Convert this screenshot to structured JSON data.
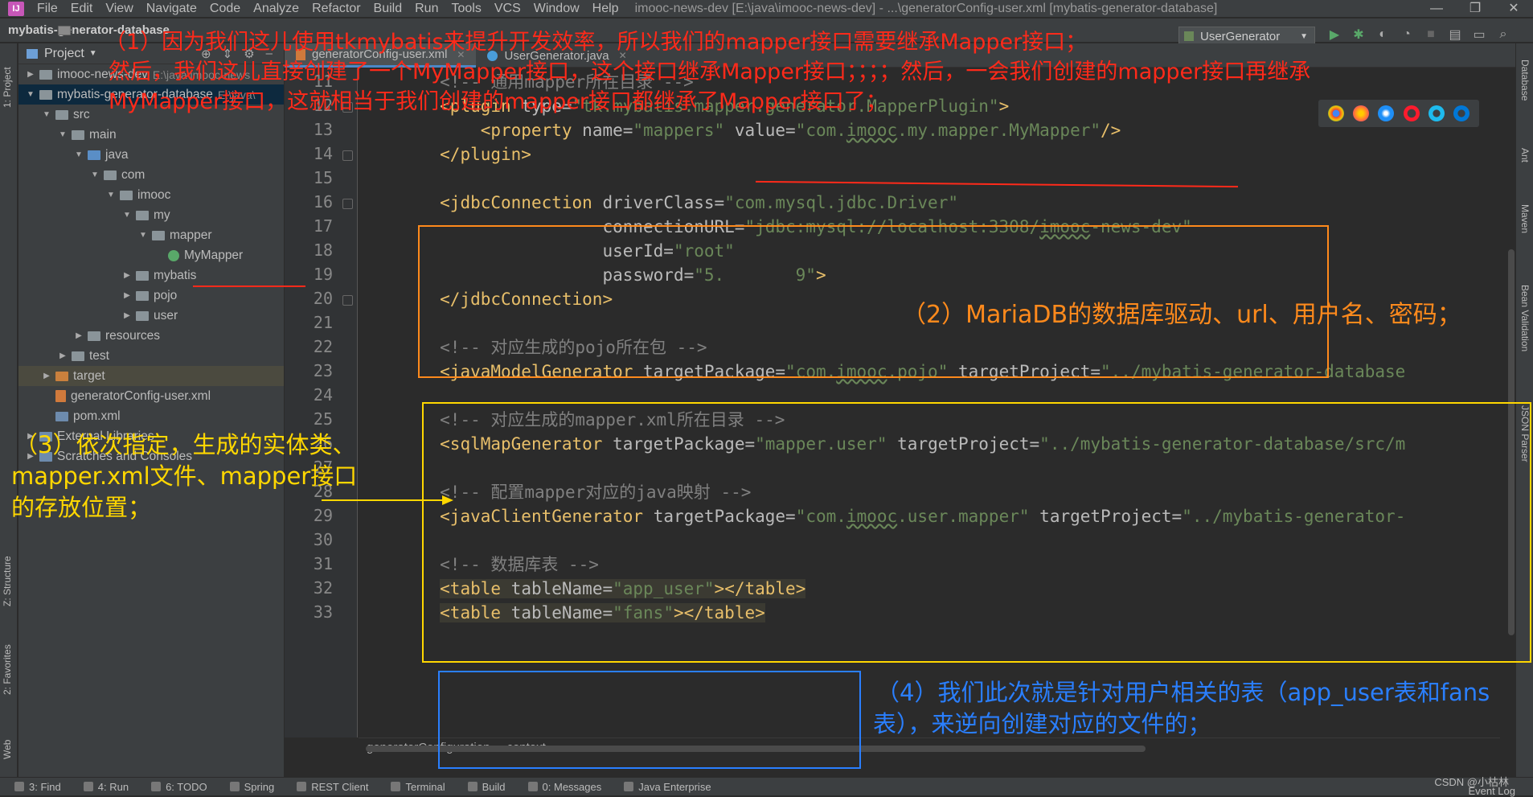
{
  "menubar": {
    "logo": "IJ",
    "items": [
      "File",
      "Edit",
      "View",
      "Navigate",
      "Code",
      "Analyze",
      "Refactor",
      "Build",
      "Run",
      "Tools",
      "VCS",
      "Window",
      "Help"
    ],
    "title": "imooc-news-dev [E:\\java\\imooc-news-dev] - ...\\generatorConfig-user.xml [mybatis-generator-database]",
    "controls": [
      "—",
      "❐",
      "✕"
    ]
  },
  "navbar": {
    "crumb": "mybatis-generator-database",
    "run_config": "UserGenerator"
  },
  "left_strip": [
    "1: Project",
    "Z: Structure",
    "2: Favorites",
    "Web"
  ],
  "right_strip": [
    "Database",
    "Ant",
    "Maven",
    "Bean Validation",
    "JSON Parser"
  ],
  "project": {
    "header": "Project",
    "tree": [
      {
        "label": "imooc-news-dev",
        "path": "E:\\java\\imooc-news",
        "indent": 0,
        "tw": "▶",
        "icon": "folder"
      },
      {
        "label": "mybatis-generator-database",
        "path": "E:\\java\\",
        "indent": 0,
        "tw": "▼",
        "icon": "folder",
        "sel": true
      },
      {
        "label": "src",
        "indent": 1,
        "tw": "▼",
        "icon": "folder"
      },
      {
        "label": "main",
        "indent": 2,
        "tw": "▼",
        "icon": "folder"
      },
      {
        "label": "java",
        "indent": 3,
        "tw": "▼",
        "icon": "src"
      },
      {
        "label": "com",
        "indent": 4,
        "tw": "▼",
        "icon": "folder"
      },
      {
        "label": "imooc",
        "indent": 5,
        "tw": "▼",
        "icon": "folder"
      },
      {
        "label": "my",
        "indent": 6,
        "tw": "▼",
        "icon": "folder"
      },
      {
        "label": "mapper",
        "indent": 7,
        "tw": "▼",
        "icon": "folder"
      },
      {
        "label": "MyMapper",
        "indent": 8,
        "tw": "",
        "icon": "java"
      },
      {
        "label": "mybatis",
        "indent": 6,
        "tw": "▶",
        "icon": "folder"
      },
      {
        "label": "pojo",
        "indent": 6,
        "tw": "▶",
        "icon": "folder"
      },
      {
        "label": "user",
        "indent": 6,
        "tw": "▶",
        "icon": "folder"
      },
      {
        "label": "resources",
        "indent": 3,
        "tw": "▶",
        "icon": "folder"
      },
      {
        "label": "test",
        "indent": 2,
        "tw": "▶",
        "icon": "folder"
      },
      {
        "label": "target",
        "indent": 1,
        "tw": "▶",
        "icon": "orange",
        "hi": true
      },
      {
        "label": "generatorConfig-user.xml",
        "indent": 1,
        "tw": "",
        "icon": "xml"
      },
      {
        "label": "pom.xml",
        "indent": 1,
        "tw": "",
        "icon": "m"
      },
      {
        "label": "External Libraries",
        "indent": 0,
        "tw": "▶",
        "icon": "lib"
      },
      {
        "label": "Scratches and Consoles",
        "indent": 0,
        "tw": "▶",
        "icon": "lib"
      }
    ]
  },
  "tabs": [
    {
      "label": "generatorConfig-user.xml",
      "active": true,
      "kind": "xml"
    },
    {
      "label": "UserGenerator.java",
      "active": false,
      "kind": "java"
    }
  ],
  "gutter": [
    11,
    12,
    13,
    14,
    15,
    16,
    17,
    18,
    19,
    20,
    21,
    22,
    23,
    24,
    25,
    26,
    27,
    28,
    29,
    30,
    31,
    32,
    33
  ],
  "code": [
    {
      "n": 11,
      "html": "<span class=\"c\">        &lt;!-- 通用mapper所在目录 --&gt;</span>"
    },
    {
      "n": 12,
      "html": "        <span class=\"t\">&lt;plugin</span> <span class=\"a\">type=</span><span class=\"s\">\"tk.mybatis.mapper.generator.MapperPlugin\"</span><span class=\"t\">&gt;</span>"
    },
    {
      "n": 13,
      "html": "            <span class=\"t\">&lt;property</span> <span class=\"a\">name=</span><span class=\"s\">\"mappers\"</span> <span class=\"a\">value=</span><span class=\"s\">\"com.<span class=\"u\">imooc</span>.my.mapper.MyMapper\"</span><span class=\"t\">/&gt;</span>"
    },
    {
      "n": 14,
      "html": "        <span class=\"t\">&lt;/plugin&gt;</span>"
    },
    {
      "n": 15,
      "html": ""
    },
    {
      "n": 16,
      "html": "        <span class=\"t\">&lt;jdbcConnection</span> <span class=\"a\">driverClass=</span><span class=\"s\">\"com.mysql.jdbc.Driver\"</span>"
    },
    {
      "n": 17,
      "html": "                        <span class=\"a\">connectionURL=</span><span class=\"s\">\"jdbc:mysql://localhost:3308/<span class=\"u\">imooc</span>-news-dev\"</span>"
    },
    {
      "n": 18,
      "html": "                        <span class=\"a\">userId=</span><span class=\"s\">\"root\"</span>"
    },
    {
      "n": 19,
      "html": "                        <span class=\"a\">password=</span><span class=\"s\">\"5.       9\"</span><span class=\"t\">&gt;</span>"
    },
    {
      "n": 20,
      "html": "        <span class=\"t\">&lt;/jdbcConnection&gt;</span>"
    },
    {
      "n": 21,
      "html": ""
    },
    {
      "n": 22,
      "html": "        <span class=\"c\">&lt;!-- 对应生成的pojo所在包 --&gt;</span>"
    },
    {
      "n": 23,
      "html": "        <span class=\"t\">&lt;javaModelGenerator</span> <span class=\"a\">targetPackage=</span><span class=\"s\">\"com.<span class=\"u\">imooc</span>.pojo\"</span> <span class=\"a\">targetProject=</span><span class=\"s\">\"../mybatis-generator-database</span>"
    },
    {
      "n": 24,
      "html": ""
    },
    {
      "n": 25,
      "html": "        <span class=\"c\">&lt;!-- 对应生成的mapper.xml所在目录 --&gt;</span>"
    },
    {
      "n": 26,
      "html": "        <span class=\"t\">&lt;sqlMapGenerator</span> <span class=\"a\">targetPackage=</span><span class=\"s\">\"mapper.user\"</span> <span class=\"a\">targetProject=</span><span class=\"s\">\"../mybatis-generator-database/src/m</span>"
    },
    {
      "n": 27,
      "html": ""
    },
    {
      "n": 28,
      "html": "        <span class=\"c\">&lt;!-- 配置mapper对应的java映射 --&gt;</span>"
    },
    {
      "n": 29,
      "html": "        <span class=\"t\">&lt;javaClientGenerator</span> <span class=\"a\">targetPackage=</span><span class=\"s\">\"com.<span class=\"u\">imooc</span>.user.mapper\"</span> <span class=\"a\">targetProject=</span><span class=\"s\">\"../mybatis-generator-</span>"
    },
    {
      "n": 30,
      "html": ""
    },
    {
      "n": 31,
      "html": "        <span class=\"c\">&lt;!-- 数据库表 --&gt;</span>"
    },
    {
      "n": 32,
      "html": "        <span class=\"hl\"><span class=\"t\">&lt;table</span> <span class=\"a\">tableName=</span><span class=\"s\">\"app_user\"</span><span class=\"t\">&gt;&lt;/table&gt;</span></span>"
    },
    {
      "n": 33,
      "html": "        <span class=\"hl\"><span class=\"t\">&lt;table</span> <span class=\"a\">tableName=</span><span class=\"s\">\"fans\"</span><span class=\"t\">&gt;&lt;/table&gt;</span></span>"
    }
  ],
  "breadcrumb": [
    "generatorConfiguration",
    "context"
  ],
  "bottom": [
    "3: Find",
    "4: Run",
    "6: TODO",
    "Spring",
    "REST Client",
    "Terminal",
    "Build",
    "0: Messages",
    "Java Enterprise"
  ],
  "event_log": "Event Log",
  "watermark": "CSDN @小枯林",
  "annotations": {
    "a1_l1": "（1）因为我们这儿使用tkmybatis来提升开发效率，所以我们的mapper接口需要继承Mapper接口；",
    "a1_l2": "然后，我们这儿直接创建了一个MyMapper接口，这个接口继承Mapper接口；；；；然后，一会我们创建的mapper接口再继承",
    "a1_l3": "MyMapper接口，这就相当于我们创建的mapper接口都继承了Mapper接口了；",
    "a2": "（2）MariaDB的数据库驱动、url、用户名、密码；",
    "a3_l1": "（3）依次指定，生成的实体类、",
    "a3_l2": "mapper.xml文件、mapper接口",
    "a3_l3": "的存放位置；",
    "a4_l1": "（4）我们此次就是针对用户相关的表（app_user表和fans",
    "a4_l2": "表），来逆向创建对应的文件的；"
  },
  "colors": {
    "red": "#ff2a1a",
    "orange": "#ff8a1c",
    "yellow": "#ffd700",
    "blue": "#2a7fff"
  }
}
